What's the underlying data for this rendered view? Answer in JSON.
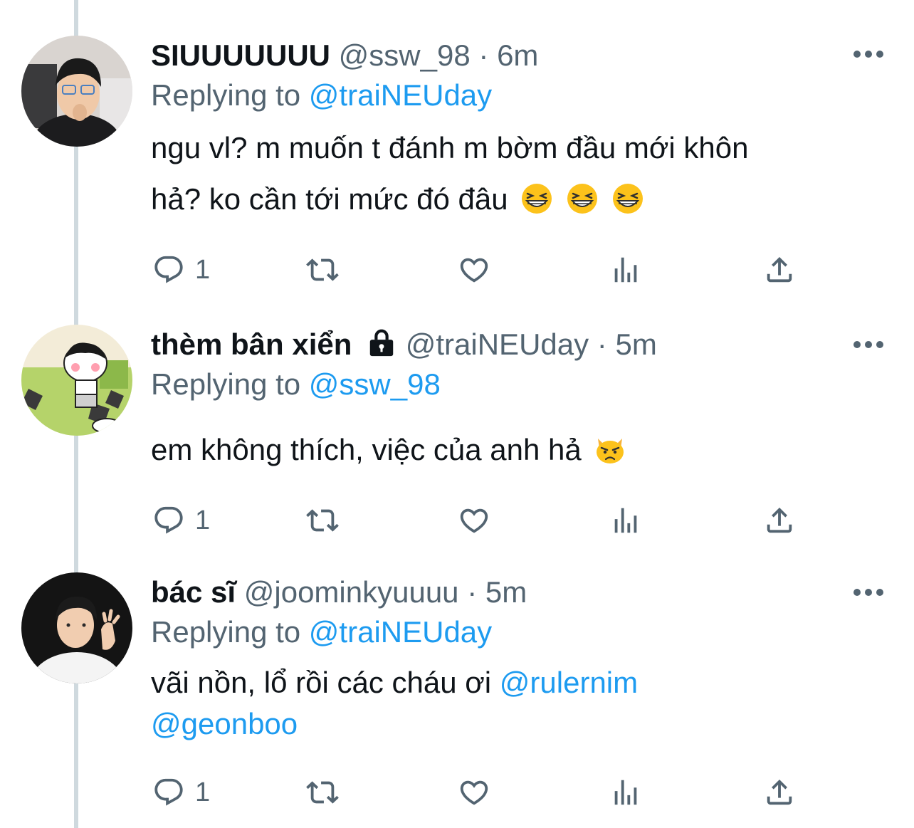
{
  "tweets": [
    {
      "display_name": "SIUUUUUUU",
      "handle": "@ssw_98",
      "separator": "·",
      "time": "6m",
      "replying_prefix": "Replying to",
      "replying_to": "@traiNEUday",
      "text_line1": "ngu vl? m muốn t đánh m bờm đầu mới khôn",
      "text_line2": "hả? ko cần tới mức đó đâu",
      "emoji": [
        "grinning-squinting-face",
        "grinning-squinting-face",
        "grinning-squinting-face"
      ],
      "reply_count": "1",
      "locked": false
    },
    {
      "display_name": "thèm bân xiển",
      "handle": "@traiNEUday",
      "separator": "·",
      "time": "5m",
      "replying_prefix": "Replying to",
      "replying_to": "@ssw_98",
      "text_line1": "em không thích, việc của anh hả",
      "emoji": [
        "pouting-cat-face"
      ],
      "reply_count": "1",
      "locked": true
    },
    {
      "display_name": "bác sĩ",
      "handle": "@joominkyuuuu",
      "separator": "·",
      "time": "5m",
      "replying_prefix": "Replying to",
      "replying_to": "@traiNEUday",
      "text_line1": "vãi nồn, lổ rồi các cháu ơi",
      "mention1": "@rulernim",
      "mention2": "@geonboo",
      "reply_count": "1",
      "locked": false
    }
  ],
  "colors": {
    "text": "#0f1419",
    "secondary": "#536471",
    "link": "#1d9bf0",
    "thread_line": "#cfd9de"
  },
  "icons": [
    "reply-icon",
    "retweet-icon",
    "like-icon",
    "analytics-icon",
    "share-icon",
    "more-icon",
    "lock-icon"
  ]
}
